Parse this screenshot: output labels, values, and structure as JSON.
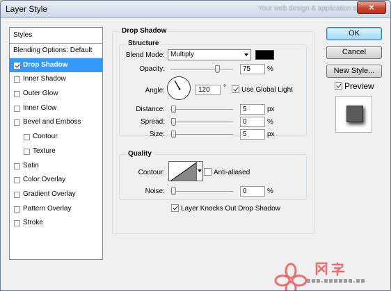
{
  "window": {
    "title": "Layer Style",
    "faint_title": "Your web design & application studio",
    "close_glyph": "×"
  },
  "styles_panel": {
    "header": "Styles",
    "items": [
      {
        "label": "Blending Options: Default",
        "checkbox": false,
        "checked": false,
        "selected": false,
        "indent": false
      },
      {
        "label": "Drop Shadow",
        "checkbox": true,
        "checked": true,
        "selected": true,
        "indent": false
      },
      {
        "label": "Inner Shadow",
        "checkbox": true,
        "checked": false,
        "selected": false,
        "indent": false
      },
      {
        "label": "Outer Glow",
        "checkbox": true,
        "checked": false,
        "selected": false,
        "indent": false
      },
      {
        "label": "Inner Glow",
        "checkbox": true,
        "checked": false,
        "selected": false,
        "indent": false
      },
      {
        "label": "Bevel and Emboss",
        "checkbox": true,
        "checked": false,
        "selected": false,
        "indent": false
      },
      {
        "label": "Contour",
        "checkbox": true,
        "checked": false,
        "selected": false,
        "indent": true
      },
      {
        "label": "Texture",
        "checkbox": true,
        "checked": false,
        "selected": false,
        "indent": true
      },
      {
        "label": "Satin",
        "checkbox": true,
        "checked": false,
        "selected": false,
        "indent": false
      },
      {
        "label": "Color Overlay",
        "checkbox": true,
        "checked": false,
        "selected": false,
        "indent": false
      },
      {
        "label": "Gradient Overlay",
        "checkbox": true,
        "checked": false,
        "selected": false,
        "indent": false
      },
      {
        "label": "Pattern Overlay",
        "checkbox": true,
        "checked": false,
        "selected": false,
        "indent": false
      },
      {
        "label": "Stroke",
        "checkbox": true,
        "checked": false,
        "selected": false,
        "indent": false
      }
    ]
  },
  "drop_shadow": {
    "group_title": "Drop Shadow",
    "structure": {
      "title": "Structure",
      "blend_mode_label": "Blend Mode:",
      "blend_mode_value": "Multiply",
      "shadow_color": "#000000",
      "opacity_label": "Opacity:",
      "opacity_value": "75",
      "opacity_unit": "%",
      "opacity_level": 0.75,
      "angle_label": "Angle:",
      "angle_value": "120",
      "angle_degrees": 120,
      "angle_unit": "°",
      "use_global_light_label": "Use Global Light",
      "use_global_light_checked": true,
      "distance_label": "Distance:",
      "distance_value": "5",
      "distance_unit": "px",
      "spread_label": "Spread:",
      "spread_value": "0",
      "spread_unit": "%",
      "size_label": "Size:",
      "size_value": "5",
      "size_unit": "px"
    },
    "quality": {
      "title": "Quality",
      "contour_label": "Contour:",
      "anti_aliased_label": "Anti-aliased",
      "anti_aliased_checked": false,
      "noise_label": "Noise:",
      "noise_value": "0",
      "noise_unit": "%"
    },
    "layer_knocks_out_label": "Layer Knocks Out Drop Shadow",
    "layer_knocks_out_checked": true
  },
  "buttons": {
    "ok": "OK",
    "cancel": "Cancel",
    "new_style": "New Style...",
    "preview_label": "Preview",
    "preview_checked": true
  },
  "watermark": {
    "glyphs": "网 学",
    "url": "WWW.MYEDUCS.CN"
  },
  "colors": {
    "selection": "#3399ff",
    "dialog_bg": "#f0f0f0",
    "close_button": "#c7432d",
    "watermark_red": "#e87070"
  }
}
